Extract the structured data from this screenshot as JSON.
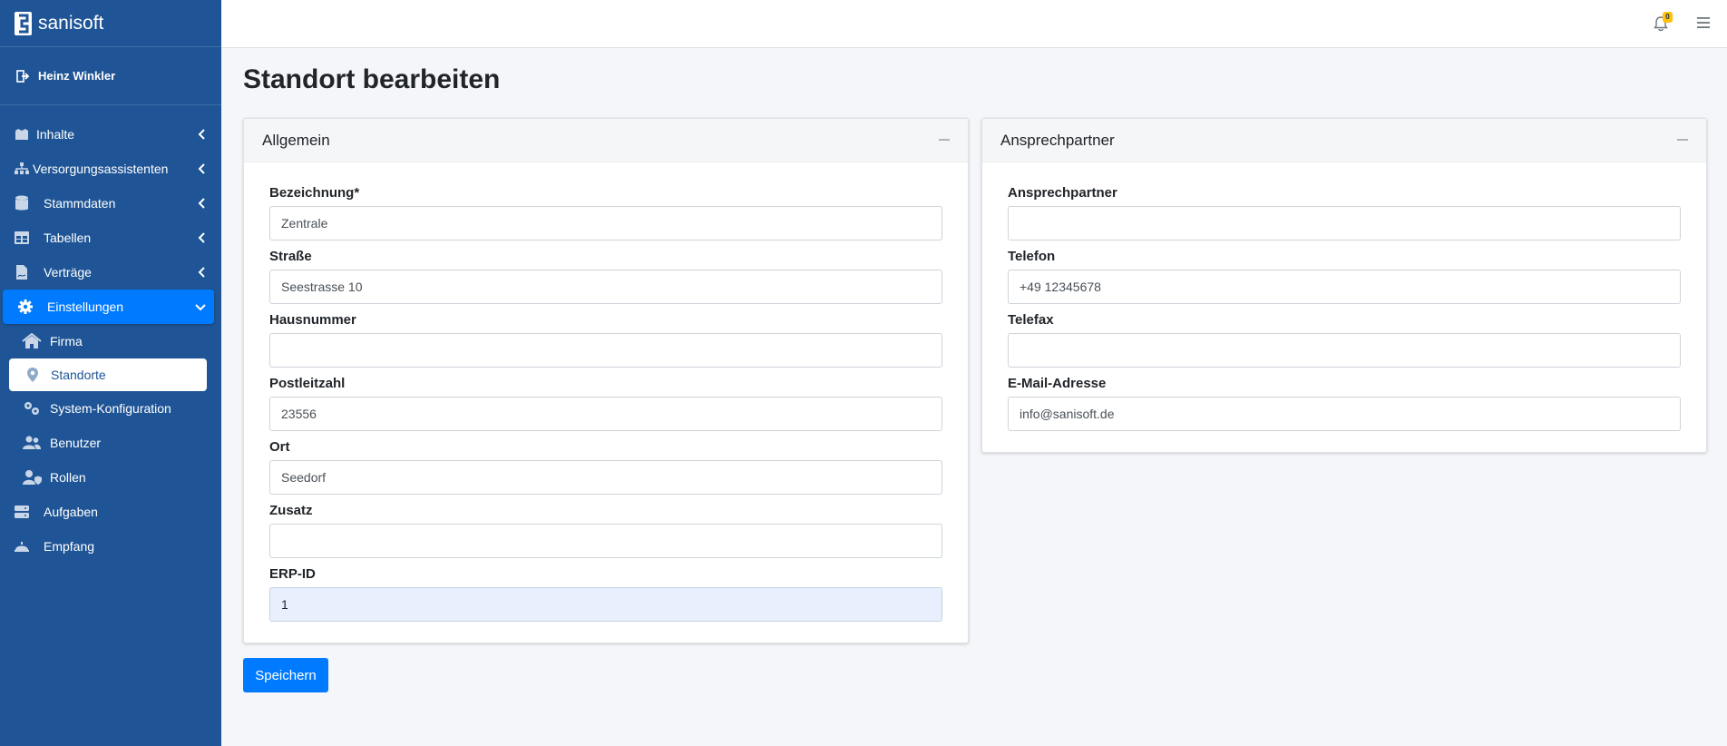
{
  "brand": {
    "name": "sanisoft"
  },
  "user": {
    "name": "Heinz Winkler"
  },
  "sidebar": {
    "items": [
      {
        "label": "Inhalte"
      },
      {
        "label": "Versorgungsassistenten"
      },
      {
        "label": "Stammdaten"
      },
      {
        "label": "Tabellen"
      },
      {
        "label": "Verträge"
      },
      {
        "label": "Einstellungen"
      }
    ],
    "sub_items": [
      {
        "label": "Firma"
      },
      {
        "label": "Standorte"
      },
      {
        "label": "System-Konfiguration"
      },
      {
        "label": "Benutzer"
      },
      {
        "label": "Rollen"
      }
    ],
    "extra_items": [
      {
        "label": "Aufgaben"
      },
      {
        "label": "Empfang"
      }
    ]
  },
  "topbar": {
    "notification_count": "0"
  },
  "page": {
    "title": "Standort bearbeiten"
  },
  "general": {
    "title": "Allgemein",
    "fields": [
      {
        "label": "Bezeichnung*",
        "value": "Zentrale"
      },
      {
        "label": "Straße",
        "value": "Seestrasse 10"
      },
      {
        "label": "Hausnummer",
        "value": ""
      },
      {
        "label": "Postleitzahl",
        "value": "23556"
      },
      {
        "label": "Ort",
        "value": "Seedorf"
      },
      {
        "label": "Zusatz",
        "value": ""
      },
      {
        "label": "ERP-ID",
        "value": "1"
      }
    ]
  },
  "contact": {
    "title": "Ansprechpartner",
    "fields": [
      {
        "label": "Ansprechpartner",
        "value": ""
      },
      {
        "label": "Telefon",
        "value": "+49 12345678"
      },
      {
        "label": "Telefax",
        "value": ""
      },
      {
        "label": "E-Mail-Adresse",
        "value": "info@sanisoft.de"
      }
    ]
  },
  "actions": {
    "save_label": "Speichern"
  },
  "colors": {
    "sidebar": "#1f5596",
    "accent": "#007bff",
    "badge": "#ffc107"
  }
}
